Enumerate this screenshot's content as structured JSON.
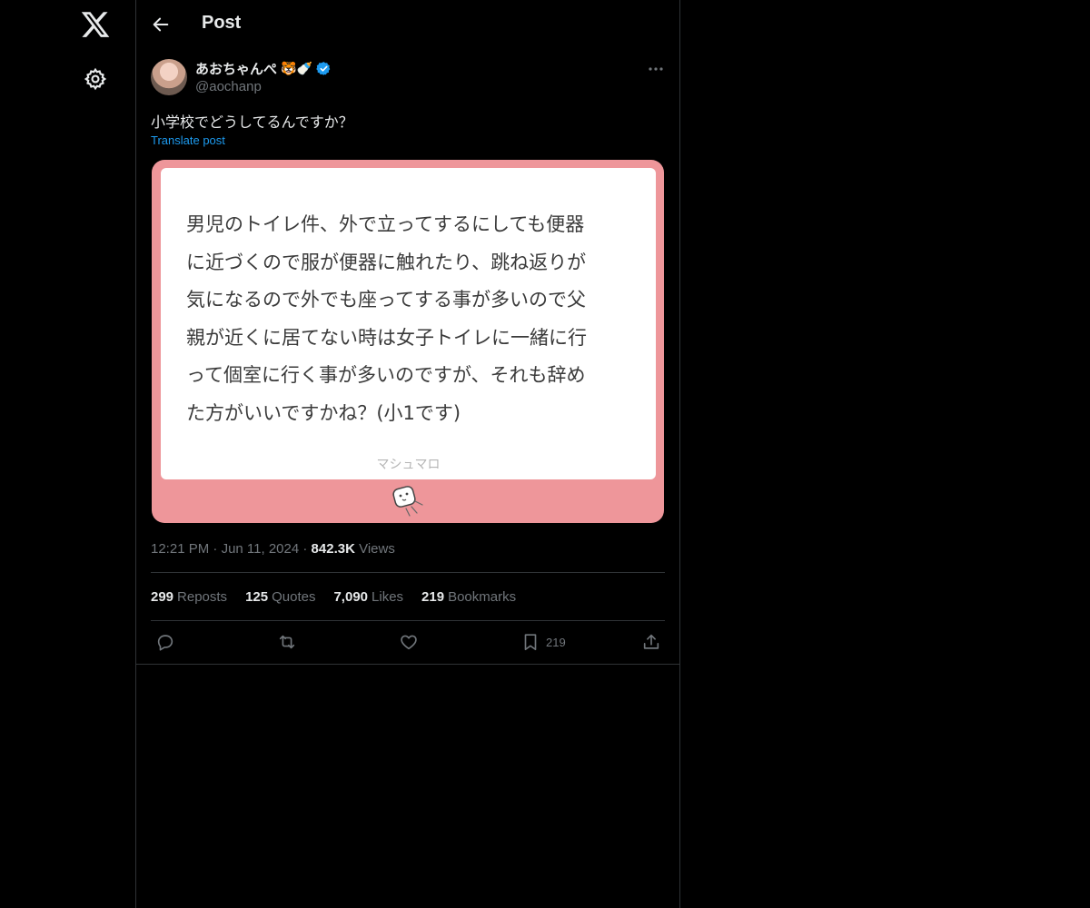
{
  "nav": {
    "logo_icon": "x-logo-icon",
    "settings_icon": "gear-icon"
  },
  "header": {
    "title": "Post",
    "back_icon": "arrow-left-icon"
  },
  "post": {
    "author_name": "あおちゃんぺ",
    "author_emoji": "🐯🍼",
    "handle": "@aochanp",
    "text": "小学校でどうしてるんですか？",
    "translate_label": "Translate post",
    "card": {
      "text": "男児のトイレ件、外で立ってするにしても便器\nに近づくので服が便器に触れたり、跳ね返りが\n気になるので外でも座ってする事が多いので父\n親が近くに居てない時は女子トイレに一緒に行\nって個室に行く事が多いのですが、それも辞め\nた方がいいですかね？(小1です)",
      "brand": "マシュマロ",
      "border_color": "#ee969a"
    },
    "time": "12:21 PM",
    "date": "Jun 11, 2024",
    "views_count": "842.3K",
    "views_label": "Views",
    "stats": {
      "reposts": "299",
      "reposts_label": "Reposts",
      "quotes": "125",
      "quotes_label": "Quotes",
      "likes": "7,090",
      "likes_label": "Likes",
      "bookmarks": "219",
      "bookmarks_label": "Bookmarks"
    },
    "actions": {
      "bookmark_count": "219"
    }
  },
  "colors": {
    "background": "#000000",
    "accent": "#1d9bf0",
    "muted": "#71767b",
    "border": "#2f3336"
  }
}
